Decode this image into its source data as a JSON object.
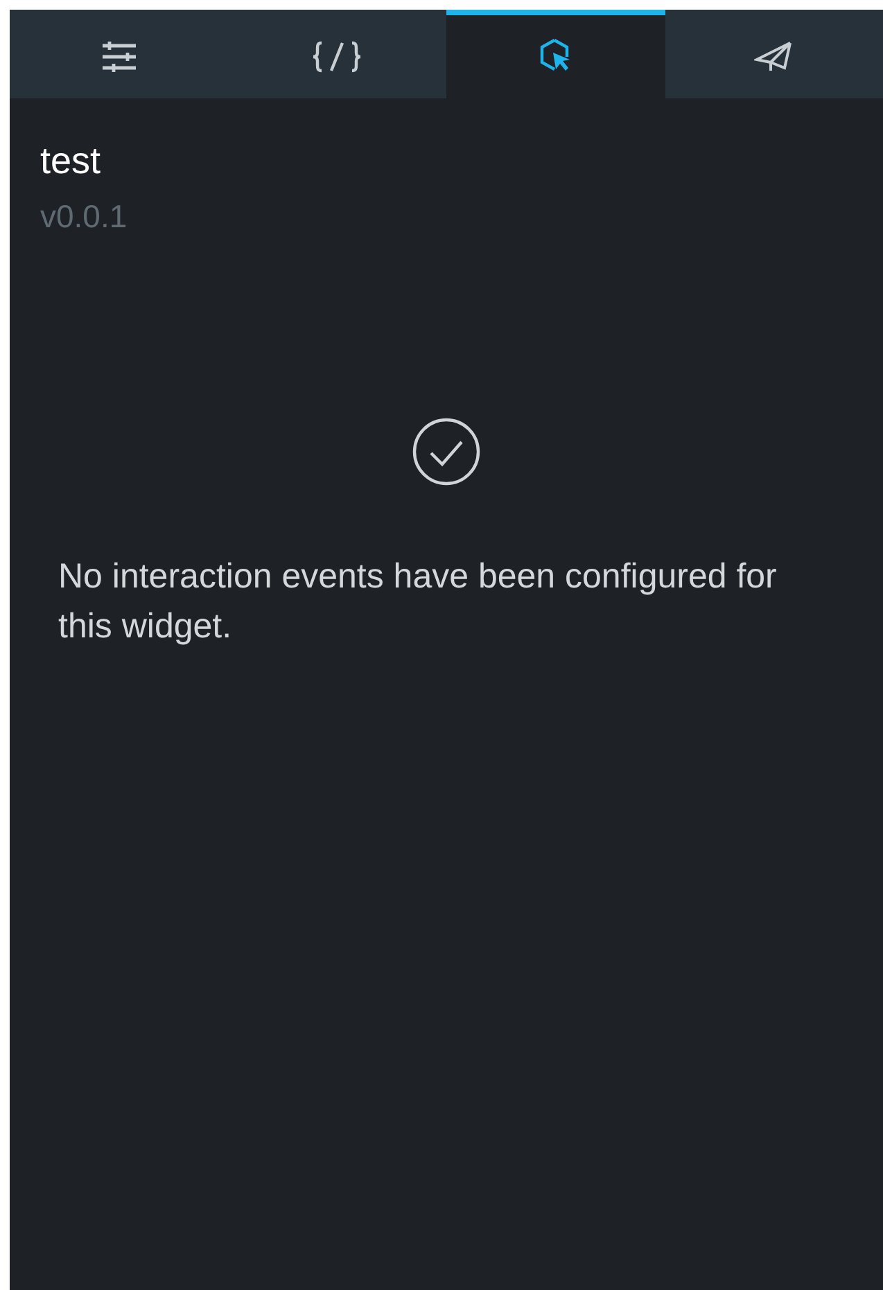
{
  "tabs": [
    {
      "kind": "settings",
      "selected": false
    },
    {
      "kind": "code",
      "selected": false
    },
    {
      "kind": "interaction",
      "selected": true
    },
    {
      "kind": "send",
      "selected": false
    }
  ],
  "widget": {
    "name": "test",
    "version": "v0.0.1"
  },
  "empty_state": {
    "message": "No interaction events have been configured for this widget."
  }
}
